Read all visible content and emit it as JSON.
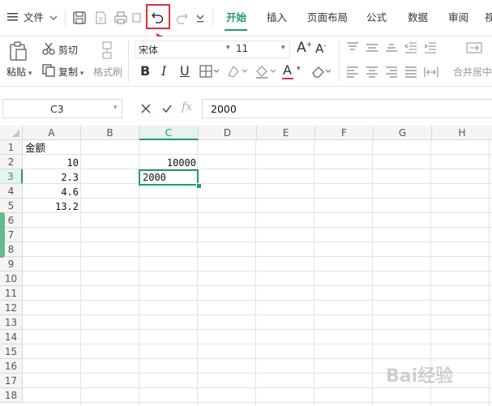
{
  "topbar": {
    "menu_label": "文件",
    "tabs": [
      "开始",
      "插入",
      "页面布局",
      "公式",
      "数据",
      "审阅",
      "视"
    ],
    "active_tab": "开始",
    "accent": "#1a9e6f",
    "highlight": "#e03030"
  },
  "ribbon": {
    "paste": "粘贴",
    "cut": "剪切",
    "copy": "复制",
    "format_painter": "格式刷",
    "font_name": "宋体",
    "font_size": "11",
    "bold": "B",
    "italic": "I",
    "underline": "U",
    "font_color_letter": "A",
    "merge_center": "合并居中"
  },
  "formula_bar": {
    "name_box": "C3",
    "fx": "fx",
    "value": "2000"
  },
  "sheet": {
    "columns": [
      "A",
      "B",
      "C",
      "D",
      "E",
      "F",
      "G",
      "H"
    ],
    "rows": [
      "1",
      "2",
      "3",
      "4",
      "5",
      "6",
      "7",
      "8",
      "9",
      "10",
      "11",
      "12",
      "13",
      "14",
      "15",
      "16",
      "17",
      "18"
    ],
    "cells": {
      "A1": "金额",
      "A2": "10",
      "A3": "2.3",
      "A4": "4.6",
      "A5": "13.2",
      "C2": "10000",
      "C3": "2000"
    },
    "active_cell": "C3"
  },
  "watermark": "Bai经验"
}
